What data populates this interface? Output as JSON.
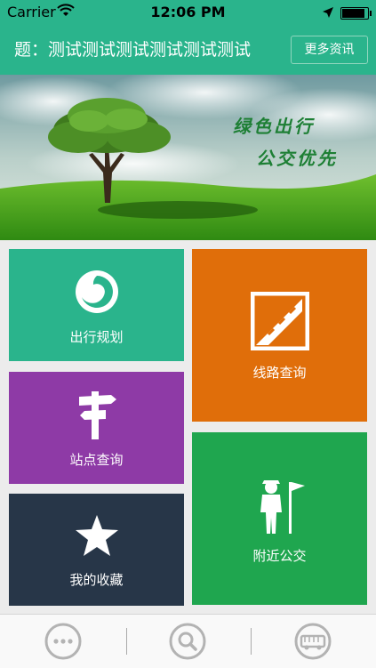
{
  "status_bar": {
    "carrier": "Carrier",
    "time": "12:06 PM",
    "battery_level": 0.95
  },
  "header": {
    "title": "题：测试测试测试测试测试测试",
    "more_button_label": "更多资讯"
  },
  "banner": {
    "slogan_line1": "绿色出行",
    "slogan_line2": "公交优先"
  },
  "tiles": {
    "route_planning": "出行规划",
    "line_query": "线路查询",
    "stop_query": "站点查询",
    "nearby_bus": "附近公交",
    "favorites": "我的收藏"
  },
  "tab_bar": {
    "items": [
      {
        "icon": "more-icon"
      },
      {
        "icon": "search-icon"
      },
      {
        "icon": "bus-icon"
      }
    ]
  },
  "colors": {
    "brand": "#2ab48c",
    "route_tile": "#2ab48c",
    "line_tile": "#e06e0a",
    "stop_tile": "#8e3aa6",
    "nearby_tile": "#1fa64f",
    "favorites_tile": "#273648"
  }
}
